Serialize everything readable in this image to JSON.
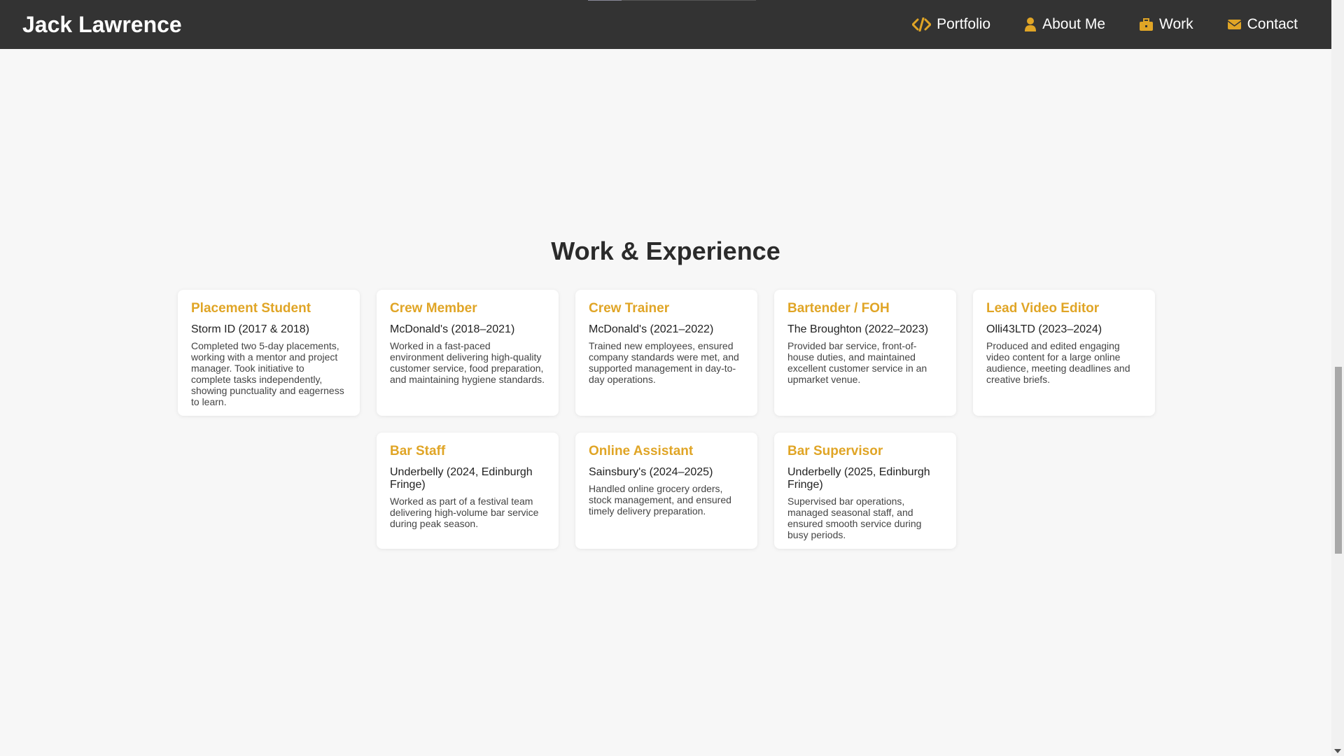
{
  "header": {
    "brand": "Jack Lawrence",
    "nav": [
      {
        "label": "Portfolio",
        "icon": "code-icon"
      },
      {
        "label": "About Me",
        "icon": "user-icon"
      },
      {
        "label": "Work",
        "icon": "briefcase-icon"
      },
      {
        "label": "Contact",
        "icon": "envelope-icon"
      }
    ],
    "accent": "#e0a526"
  },
  "section": {
    "title": "Work & Experience",
    "row1": [
      {
        "title": "Placement Student",
        "org": "Storm ID (2017 & 2018)",
        "desc": "Completed two 5-day placements, working with a mentor and project manager. Took initiative to complete tasks independently, showing punctuality and eagerness to learn."
      },
      {
        "title": "Crew Member",
        "org": "McDonald's (2018–2021)",
        "desc": "Worked in a fast-paced environment delivering high-quality customer service, food preparation, and maintaining hygiene standards."
      },
      {
        "title": "Crew Trainer",
        "org": "McDonald's (2021–2022)",
        "desc": "Trained new employees, ensured company standards were met, and supported management in day-to-day operations."
      },
      {
        "title": "Bartender / FOH",
        "org": "The Broughton (2022–2023)",
        "desc": "Provided bar service, front-of-house duties, and maintained excellent customer service in an upmarket venue."
      },
      {
        "title": "Lead Video Editor",
        "org": "Olli43LTD (2023–2024)",
        "desc": "Produced and edited engaging video content for a large online audience, meeting deadlines and creative briefs."
      }
    ],
    "row2": [
      {
        "title": "Bar Staff",
        "org": "Underbelly (2024, Edinburgh Fringe)",
        "desc": "Worked as part of a festival team delivering high-volume bar service during peak season."
      },
      {
        "title": "Online Assistant",
        "org": "Sainsbury's (2024–2025)",
        "desc": "Handled online grocery orders, stock management, and ensured timely delivery preparation."
      },
      {
        "title": "Bar Supervisor",
        "org": "Underbelly (2025, Edinburgh Fringe)",
        "desc": "Supervised bar operations, managed seasonal staff, and ensured smooth service during busy periods."
      }
    ]
  }
}
